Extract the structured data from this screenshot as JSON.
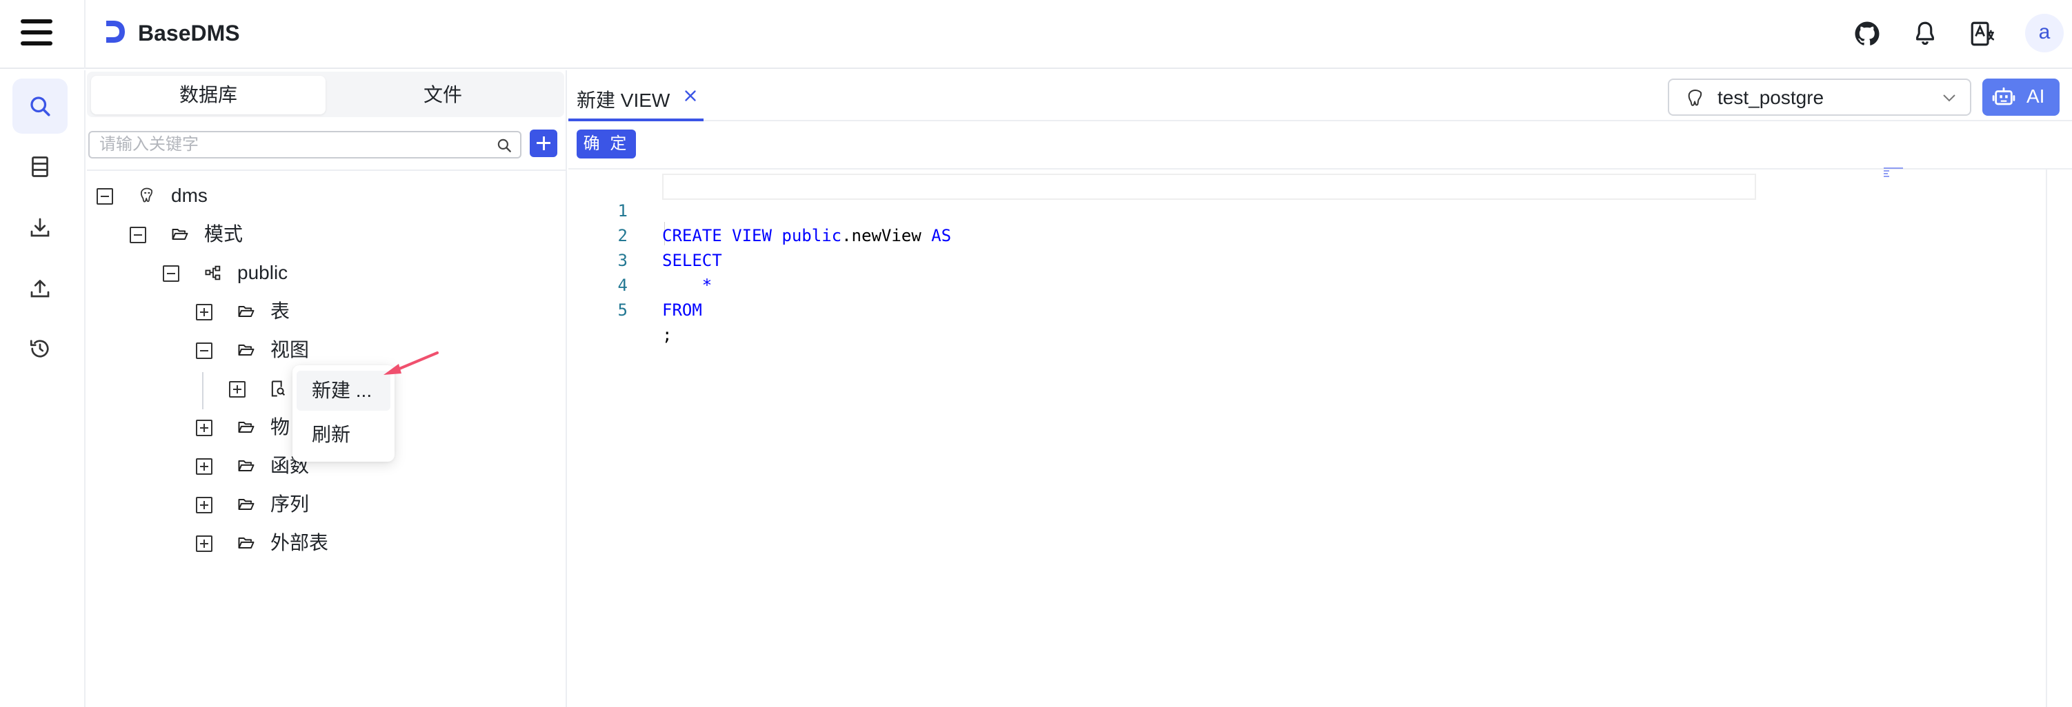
{
  "app": {
    "title": "BaseDMS",
    "user_avatar": "a",
    "accent_color": "#3b55e6"
  },
  "header_icons": [
    "github-icon",
    "bell-icon",
    "translate-icon"
  ],
  "rail": {
    "items": [
      "search-icon",
      "database-icon",
      "download-icon",
      "upload-icon",
      "history-icon"
    ],
    "active": "search-icon"
  },
  "sidebar": {
    "tabs": [
      "数据库",
      "文件"
    ],
    "active_tab": "数据库",
    "search": {
      "placeholder": "请输入关键字",
      "value": ""
    },
    "tree": {
      "root": "dms",
      "schema_group": "模式",
      "schema": "public",
      "tables": "表",
      "views": "视图",
      "materialized": "物",
      "functions": "函数",
      "sequences": "序列",
      "foreign_tables": "外部表"
    }
  },
  "context_menu": {
    "items": [
      "新建 ...",
      "刷新"
    ]
  },
  "editor": {
    "tab_label": "新建 VIEW",
    "database": "test_postgre",
    "ai_label": "AI",
    "confirm_label": "确 定",
    "line_numbers": [
      "1",
      "2",
      "3",
      "4",
      "5"
    ],
    "code": {
      "l1_kw1": "CREATE VIEW",
      "l1_schema": "public",
      "l1_name": ".newView ",
      "l1_kw2": "AS",
      "l2": "SELECT",
      "l3": "    *",
      "l4": "FROM",
      "l5": ";"
    }
  }
}
